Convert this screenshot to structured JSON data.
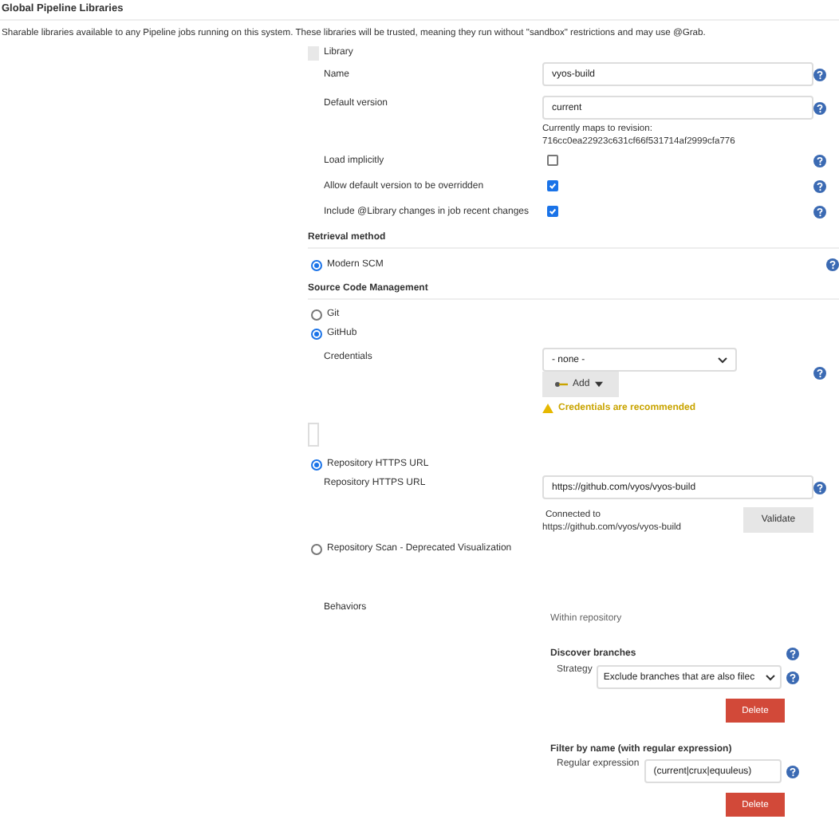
{
  "section": {
    "title": "Global Pipeline Libraries",
    "description": "Sharable libraries available to any Pipeline jobs running on this system. These libraries will be trusted, meaning they run without \"sandbox\" restrictions and may use @Grab."
  },
  "library": {
    "header": "Library",
    "name": {
      "label": "Name",
      "value": "vyos-build"
    },
    "default_version": {
      "label": "Default version",
      "value": "current",
      "note": [
        "Currently maps to revision:",
        "716cc0ea22923c631cf66f531714af2999cfa776"
      ]
    },
    "options": [
      {
        "label": "Load implicitly",
        "checked": false
      },
      {
        "label": "Allow default version to be overridden",
        "checked": true
      },
      {
        "label": "Include @Library changes in job recent changes",
        "checked": true
      }
    ]
  },
  "retrieval": {
    "heading": "Retrieval method",
    "options": [
      {
        "label": "Modern SCM",
        "selected": true
      }
    ]
  },
  "scm": {
    "heading": "Source Code Management",
    "options": [
      {
        "label": "Git",
        "selected": false
      },
      {
        "label": "GitHub",
        "selected": true
      }
    ],
    "credentials": {
      "label": "Credentials",
      "value": "- none -",
      "add_button": "Add",
      "warning": "Credentials are recommended"
    },
    "repo_modes": [
      {
        "label": "Repository HTTPS URL",
        "selected": true
      },
      {
        "label": "Repository Scan - Deprecated Visualization",
        "selected": false
      }
    ],
    "repo_url": {
      "label": "Repository HTTPS URL",
      "value": "https://github.com/vyos/vyos-build",
      "status": [
        "Connected to",
        "https://github.com/vyos/vyos-build"
      ],
      "validate_button": "Validate"
    },
    "behaviors": {
      "label": "Behaviors",
      "scope": "Within repository",
      "items": [
        {
          "kind": "select",
          "title": "Discover branches",
          "field_label": "Strategy",
          "value": "Exclude branches that are also filec",
          "delete_button": "Delete"
        },
        {
          "kind": "input",
          "title": "Filter by name (with regular expression)",
          "field_label": "Regular expression",
          "value": "(current|crux|equuleus)",
          "delete_button": "Delete"
        }
      ]
    }
  }
}
